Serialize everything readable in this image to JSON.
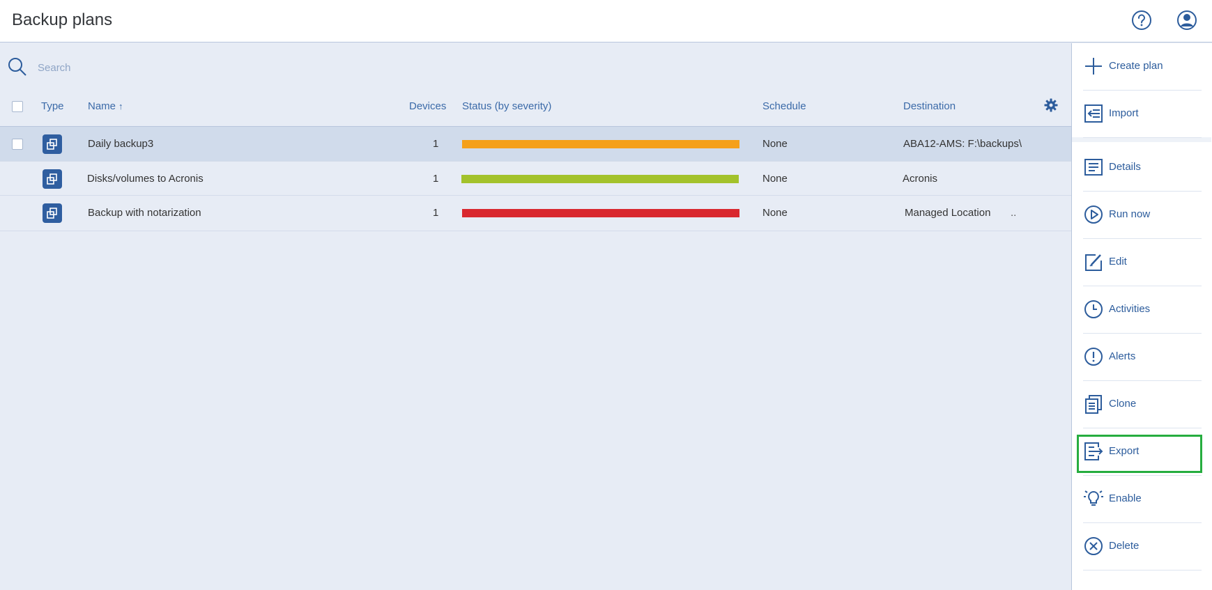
{
  "header": {
    "title": "Backup plans"
  },
  "search": {
    "placeholder": "Search"
  },
  "table": {
    "columns": {
      "type": "Type",
      "name": "Name",
      "sort_indicator": "↑",
      "devices": "Devices",
      "status": "Status (by severity)",
      "schedule": "Schedule",
      "destination": "Destination"
    },
    "rows": [
      {
        "name": "Daily backup3",
        "devices": "1",
        "status_color": "#f5a01a",
        "schedule": "None",
        "destination": "ABA12-AMS: F:\\backups\\",
        "selected": true
      },
      {
        "name": "Disks/volumes to Acronis",
        "devices": "1",
        "status_color": "#a3c22b",
        "schedule": "None",
        "destination": "Acronis",
        "selected": false
      },
      {
        "name": "Backup with notarization",
        "devices": "1",
        "status_color": "#d9282f",
        "schedule": "None",
        "destination": "Managed Location",
        "destination_suffix": "..",
        "selected": false
      }
    ]
  },
  "actions": [
    {
      "label": "Create plan",
      "icon": "plus-icon"
    },
    {
      "label": "Import",
      "icon": "import-icon"
    },
    {
      "label": "Details",
      "icon": "details-icon"
    },
    {
      "label": "Run now",
      "icon": "play-icon"
    },
    {
      "label": "Edit",
      "icon": "edit-icon"
    },
    {
      "label": "Activities",
      "icon": "clock-icon"
    },
    {
      "label": "Alerts",
      "icon": "alert-icon"
    },
    {
      "label": "Clone",
      "icon": "clone-icon"
    },
    {
      "label": "Export",
      "icon": "export-icon",
      "highlighted": true
    },
    {
      "label": "Enable",
      "icon": "bulb-icon"
    },
    {
      "label": "Delete",
      "icon": "delete-icon"
    }
  ],
  "colors": {
    "accent": "#2c5c9c",
    "highlight": "#26ad3f"
  }
}
